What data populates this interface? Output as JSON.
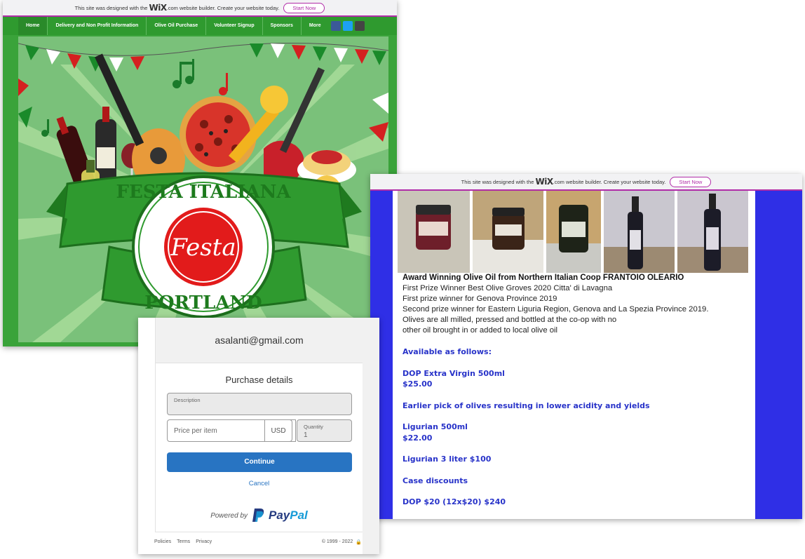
{
  "wix_banner": {
    "text_before": "This site was designed with the",
    "logo": "WiX",
    "text_after": ".com website builder. Create your website today.",
    "button": "Start Now"
  },
  "festa_site": {
    "nav": [
      "Home",
      "Delivery and Non Profit Information",
      "Olive Oil Purchase",
      "Volunteer Signup",
      "Sponsors",
      "More"
    ],
    "social_icons": [
      "facebook-icon",
      "twitter-icon",
      "google-plus-icon"
    ],
    "banner_text_top": "FESTA ITALIANA",
    "banner_logo": "Festa",
    "banner_text_bottom": "PORTLAND",
    "colors": {
      "green": "#3aa33a",
      "red": "#e21b1b",
      "white": "#ffffff"
    }
  },
  "olive_page": {
    "heading": "Award Winning Olive Oil from Northern Italian Coop FRANTOIO OLEARIO",
    "lines": [
      "First Prize Winner Best Olive Groves 2020 Citta' di Lavagna",
      "First prize winner for Genova Province 2019",
      "Second prize winner for Eastern Liguria Region, Genova and La Spezia Province 2019.",
      "Olives are all milled, pressed and bottled at the co-op with no",
      "other oil brought in or added to local olive oil"
    ],
    "available": "Available as follows:",
    "dop_title": "DOP Extra Virgin 500ml",
    "dop_price": "$25.00",
    "earlier": "Earlier pick of olives resulting in lower acidity and yields",
    "lig_title": "Ligurian 500ml",
    "lig_price": "$22.00",
    "lig3": "Ligurian 3 liter $100",
    "case": "Case discounts",
    "dop_case": "DOP $20 (12x$20) $240",
    "accent_color": "#2f2fe6"
  },
  "paypal": {
    "email": "asalanti@gmail.com",
    "title": "Purchase details",
    "description_label": "Description",
    "price_placeholder": "Price per item",
    "currency": "USD",
    "quantity_label": "Quantity",
    "quantity_value": "1",
    "continue": "Continue",
    "cancel": "Cancel",
    "powered_by": "Powered by",
    "brand_pay": "Pay",
    "brand_pal": "Pal",
    "footer_links": [
      "Policies",
      "Terms",
      "Privacy"
    ],
    "copyright": "© 1999 - 2022"
  }
}
